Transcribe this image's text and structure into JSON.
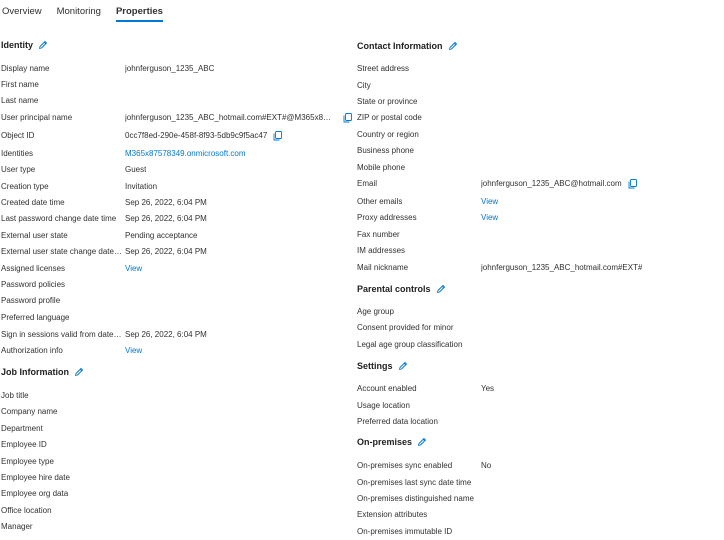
{
  "tabs": [
    {
      "label": "Overview"
    },
    {
      "label": "Monitoring"
    },
    {
      "label": "Properties"
    }
  ],
  "identity": {
    "title": "Identity",
    "rows": [
      {
        "label": "Display name",
        "value": "johnferguson_1235_ABC"
      },
      {
        "label": "First name",
        "value": ""
      },
      {
        "label": "Last name",
        "value": ""
      },
      {
        "label": "User principal name",
        "value": "johnferguson_1235_ABC_hotmail.com#EXT#@M365x8757839..."
      },
      {
        "label": "Object ID",
        "value": "0cc7f8ed-290e-458f-8f93-5db9c9f5ac47"
      },
      {
        "label": "Identities",
        "value": "M365x87578349.onmicrosoft.com"
      },
      {
        "label": "User type",
        "value": "Guest"
      },
      {
        "label": "Creation type",
        "value": "Invitation"
      },
      {
        "label": "Created date time",
        "value": "Sep 26, 2022, 6:04 PM"
      },
      {
        "label": "Last password change date time",
        "value": "Sep 26, 2022, 6:04 PM"
      },
      {
        "label": "External user state",
        "value": "Pending acceptance"
      },
      {
        "label": "External user state change date ti...",
        "value": "Sep 26, 2022, 6:04 PM"
      },
      {
        "label": "Assigned licenses",
        "value": "View"
      },
      {
        "label": "Password policies",
        "value": ""
      },
      {
        "label": "Password profile",
        "value": ""
      },
      {
        "label": "Preferred language",
        "value": ""
      },
      {
        "label": "Sign in sessions valid from date t...",
        "value": "Sep 26, 2022, 6:04 PM"
      },
      {
        "label": "Authorization info",
        "value": "View"
      }
    ]
  },
  "job": {
    "title": "Job Information",
    "rows": [
      {
        "label": "Job title"
      },
      {
        "label": "Company name"
      },
      {
        "label": "Department"
      },
      {
        "label": "Employee ID"
      },
      {
        "label": "Employee type"
      },
      {
        "label": "Employee hire date"
      },
      {
        "label": "Employee org data"
      },
      {
        "label": "Office location"
      },
      {
        "label": "Manager"
      }
    ]
  },
  "contact": {
    "title": "Contact Information",
    "rows": [
      {
        "label": "Street address",
        "value": ""
      },
      {
        "label": "City",
        "value": ""
      },
      {
        "label": "State or province",
        "value": ""
      },
      {
        "label": "ZIP or postal code",
        "value": ""
      },
      {
        "label": "Country or region",
        "value": ""
      },
      {
        "label": "Business phone",
        "value": ""
      },
      {
        "label": "Mobile phone",
        "value": ""
      },
      {
        "label": "Email",
        "value": "johnferguson_1235_ABC@hotmail.com"
      },
      {
        "label": "Other emails",
        "value": "View"
      },
      {
        "label": "Proxy addresses",
        "value": "View"
      },
      {
        "label": "Fax number",
        "value": ""
      },
      {
        "label": "IM addresses",
        "value": ""
      },
      {
        "label": "Mail nickname",
        "value": "johnferguson_1235_ABC_hotmail.com#EXT#"
      }
    ]
  },
  "parental": {
    "title": "Parental controls",
    "rows": [
      {
        "label": "Age group"
      },
      {
        "label": "Consent provided for minor"
      },
      {
        "label": "Legal age group classification"
      }
    ]
  },
  "settings": {
    "title": "Settings",
    "rows": [
      {
        "label": "Account enabled",
        "value": "Yes"
      },
      {
        "label": "Usage location",
        "value": ""
      },
      {
        "label": "Preferred data location",
        "value": ""
      }
    ]
  },
  "onprem": {
    "title": "On-premises",
    "rows": [
      {
        "label": "On-premises sync enabled",
        "value": "No"
      },
      {
        "label": "On-premises last sync date time",
        "value": ""
      },
      {
        "label": "On-premises distinguished name",
        "value": ""
      },
      {
        "label": "Extension attributes",
        "value": ""
      },
      {
        "label": "On-premises immutable ID",
        "value": ""
      }
    ]
  },
  "colors": {
    "accent": "#0078d4",
    "text": "#323130"
  }
}
